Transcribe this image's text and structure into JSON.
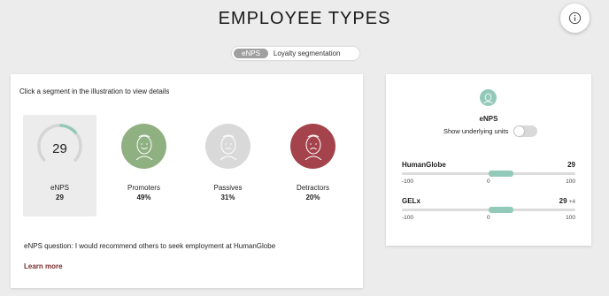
{
  "header": {
    "title": "EMPLOYEE TYPES",
    "info_icon": "info-icon"
  },
  "view_toggle": {
    "options": [
      "eNPS",
      "Loyalty segmentation"
    ],
    "selected": "eNPS"
  },
  "main": {
    "instruction": "Click a segment in the illustration to view details",
    "enps": {
      "score": "29",
      "label": "eNPS",
      "value": "29",
      "gauge_fraction": 0.145
    },
    "segments": [
      {
        "label": "Promoters",
        "value": "49%",
        "color": "#8fb081",
        "icon": "happy-face-icon"
      },
      {
        "label": "Passives",
        "value": "31%",
        "color": "#d9d9d9",
        "icon": "neutral-face-icon"
      },
      {
        "label": "Detractors",
        "value": "20%",
        "color": "#a5434c",
        "icon": "sad-face-icon"
      }
    ],
    "question": "eNPS question: I would recommend others to seek employment at HumanGlobe",
    "learn_more": "Learn more"
  },
  "side": {
    "icon": "face-icon",
    "title": "eNPS",
    "underlying_label": "Show underlying units",
    "underlying_on": false,
    "units": [
      {
        "name": "HumanGlobe",
        "score": "29",
        "delta": "",
        "value": 29,
        "min_label": "-100",
        "mid_label": "0",
        "max_label": "100"
      },
      {
        "name": "GELx",
        "score": "29",
        "delta": "+4",
        "value": 29,
        "min_label": "-100",
        "mid_label": "0",
        "max_label": "100"
      }
    ]
  }
}
